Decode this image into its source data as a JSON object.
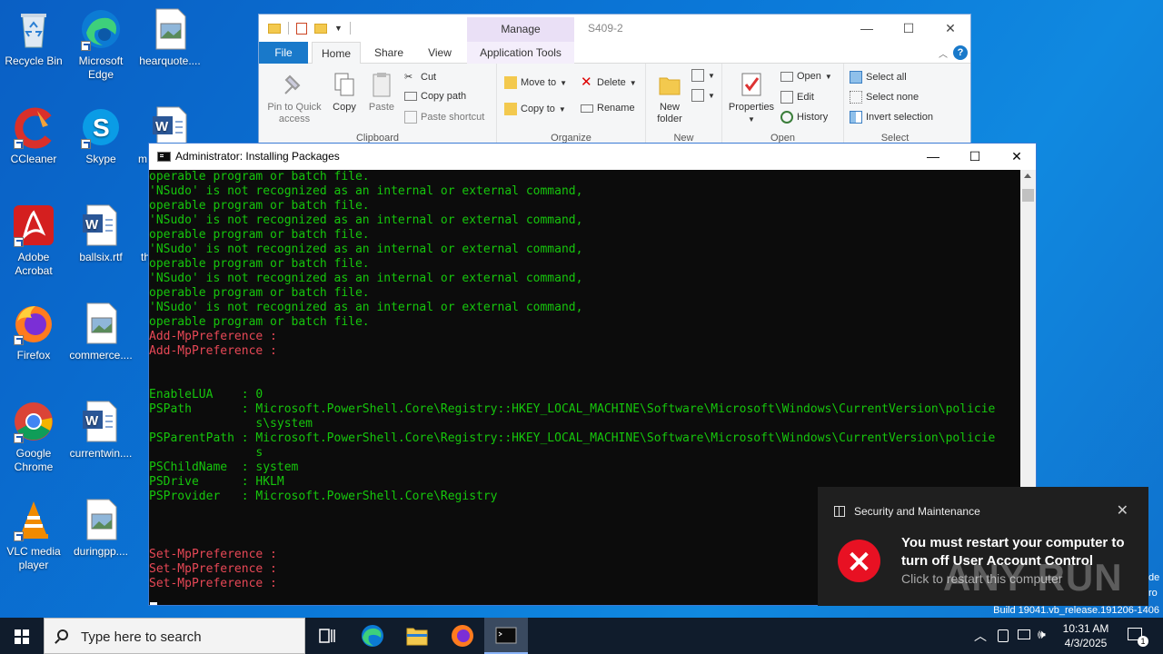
{
  "desktop": {
    "icons": [
      {
        "label": "Recycle Bin",
        "icon": "recycle-bin-icon"
      },
      {
        "label": "Microsoft Edge",
        "icon": "edge-icon"
      },
      {
        "label": "hearquote....",
        "icon": "image-file-icon"
      },
      {
        "label": "CCleaner",
        "icon": "ccleaner-icon"
      },
      {
        "label": "Skype",
        "icon": "skype-icon"
      },
      {
        "label": "m",
        "icon": "word-doc-icon"
      },
      {
        "label": "Adobe Acrobat",
        "icon": "acrobat-icon"
      },
      {
        "label": "ballsix.rtf",
        "icon": "word-doc-icon"
      },
      {
        "label": "th",
        "icon": "partial-icon"
      },
      {
        "label": "Firefox",
        "icon": "firefox-icon"
      },
      {
        "label": "commerce....",
        "icon": "image-file-icon"
      },
      {
        "label": "Google Chrome",
        "icon": "chrome-icon"
      },
      {
        "label": "currentwin....",
        "icon": "word-doc-icon"
      },
      {
        "label": "VLC media player",
        "icon": "vlc-icon"
      },
      {
        "label": "duringpp....",
        "icon": "image-file-icon"
      }
    ]
  },
  "explorer": {
    "window_title": "S409-2",
    "manage_tab": "Manage",
    "tabs": {
      "file": "File",
      "home": "Home",
      "share": "Share",
      "view": "View",
      "app_tools": "Application Tools"
    },
    "clipboard": {
      "pin": "Pin to Quick access",
      "copy": "Copy",
      "paste": "Paste",
      "cut": "Cut",
      "copy_path": "Copy path",
      "paste_shortcut": "Paste shortcut",
      "label": "Clipboard"
    },
    "organize": {
      "move_to": "Move to",
      "copy_to": "Copy to",
      "delete": "Delete",
      "rename": "Rename",
      "label": "Organize"
    },
    "new": {
      "new_folder": "New folder",
      "label": "New"
    },
    "open": {
      "properties": "Properties",
      "open": "Open",
      "edit": "Edit",
      "history": "History",
      "label": "Open"
    },
    "select": {
      "select_all": "Select all",
      "select_none": "Select none",
      "invert": "Invert selection",
      "label": "Select"
    },
    "controls": {
      "minimize": "—",
      "maximize": "☐",
      "close": "✕"
    }
  },
  "console": {
    "title": "Administrator:  Installing Packages",
    "controls": {
      "minimize": "—",
      "maximize": "☐",
      "close": "✕"
    },
    "lines": [
      {
        "text": "operable program or batch file.",
        "color": "green"
      },
      {
        "text": "'NSudo' is not recognized as an internal or external command,",
        "color": "green"
      },
      {
        "text": "operable program or batch file.",
        "color": "green"
      },
      {
        "text": "'NSudo' is not recognized as an internal or external command,",
        "color": "green"
      },
      {
        "text": "operable program or batch file.",
        "color": "green"
      },
      {
        "text": "'NSudo' is not recognized as an internal or external command,",
        "color": "green"
      },
      {
        "text": "operable program or batch file.",
        "color": "green"
      },
      {
        "text": "'NSudo' is not recognized as an internal or external command,",
        "color": "green"
      },
      {
        "text": "operable program or batch file.",
        "color": "green"
      },
      {
        "text": "'NSudo' is not recognized as an internal or external command,",
        "color": "green"
      },
      {
        "text": "operable program or batch file.",
        "color": "green"
      },
      {
        "text": "Add-MpPreference :",
        "color": "red"
      },
      {
        "text": "Add-MpPreference :",
        "color": "red"
      },
      {
        "text": "",
        "color": "green"
      },
      {
        "text": "",
        "color": "green"
      },
      {
        "text": "EnableLUA    : 0",
        "color": "green"
      },
      {
        "text": "PSPath       : Microsoft.PowerShell.Core\\Registry::HKEY_LOCAL_MACHINE\\Software\\Microsoft\\Windows\\CurrentVersion\\policie",
        "color": "green"
      },
      {
        "text": "               s\\system",
        "color": "green"
      },
      {
        "text": "PSParentPath : Microsoft.PowerShell.Core\\Registry::HKEY_LOCAL_MACHINE\\Software\\Microsoft\\Windows\\CurrentVersion\\policie",
        "color": "green"
      },
      {
        "text": "               s",
        "color": "green"
      },
      {
        "text": "PSChildName  : system",
        "color": "green"
      },
      {
        "text": "PSDrive      : HKLM",
        "color": "green"
      },
      {
        "text": "PSProvider   : Microsoft.PowerShell.Core\\Registry",
        "color": "green"
      },
      {
        "text": "",
        "color": "green"
      },
      {
        "text": "",
        "color": "green"
      },
      {
        "text": "",
        "color": "green"
      },
      {
        "text": "Set-MpPreference :",
        "color": "red"
      },
      {
        "text": "Set-MpPreference :",
        "color": "red"
      },
      {
        "text": "Set-MpPreference :",
        "color": "red"
      }
    ]
  },
  "toast": {
    "app": "Security and Maintenance",
    "heading": "You must restart your computer to turn off User Account Control",
    "subtext": "Click to restart this computer",
    "close": "✕"
  },
  "watermark": "ANY RUN",
  "build_text": "Build 19041.vb_release.191206-1406",
  "build_side": [
    "de",
    "ro"
  ],
  "taskbar": {
    "search_placeholder": "Type here to search",
    "time": "10:31 AM",
    "date": "4/3/2025",
    "notification_count": "1"
  },
  "colors": {
    "console_green": "#16c60c",
    "console_red": "#e74856",
    "accent": "#1979ca",
    "error_red": "#e81123"
  }
}
